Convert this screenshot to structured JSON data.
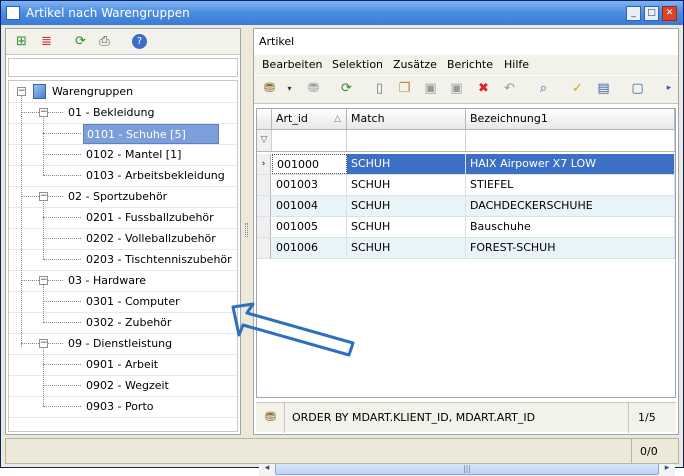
{
  "window": {
    "title": "Artikel nach Warengruppen"
  },
  "left": {
    "toolbar": [
      {
        "icon": "add-node-icon"
      },
      {
        "icon": "edit-list-icon"
      },
      {
        "icon": "refresh-icon"
      },
      {
        "icon": "print-icon"
      },
      {
        "icon": "help-icon"
      }
    ],
    "search_value": "",
    "tree": {
      "root": "Warengruppen",
      "groups": [
        {
          "label": "01 - Bekleidung",
          "children": [
            "0101 - Schuhe [5]",
            "0102 - Mantel [1]",
            "0103 - Arbeitsbekleidung"
          ]
        },
        {
          "label": "02 - Sportzubehör",
          "children": [
            "0201 - Fussballzubehör",
            "0202 - Volleballzubehör",
            "0203 - Tischtenniszubehör"
          ]
        },
        {
          "label": "03 - Hardware",
          "children": [
            "0301 - Computer",
            "0302 - Zubehör"
          ]
        },
        {
          "label": "09 - Dienstleistung",
          "children": [
            "0901 - Arbeit",
            "0902 - Wegzeit",
            "0903 - Porto"
          ]
        }
      ],
      "selected": "0101 - Schuhe [5]"
    }
  },
  "right": {
    "header": "Artikel",
    "menu": [
      "Bearbeiten",
      "Selektion",
      "Zusätze",
      "Berichte",
      "Hilfe"
    ],
    "grid": {
      "columns": [
        "Art_id",
        "Match",
        "Bezeichnung1"
      ],
      "rows": [
        {
          "art_id": "001000",
          "match": "SCHUH",
          "bezeichnung": "HAIX Airpower X7 LOW"
        },
        {
          "art_id": "001003",
          "match": "SCHUH",
          "bezeichnung": "STIEFEL"
        },
        {
          "art_id": "001004",
          "match": "SCHUH",
          "bezeichnung": "DACHDECKERSCHUHE"
        },
        {
          "art_id": "001005",
          "match": "SCHUH",
          "bezeichnung": "Bauschuhe"
        },
        {
          "art_id": "001006",
          "match": "SCHUH",
          "bezeichnung": "FOREST-SCHUH"
        }
      ]
    },
    "status": {
      "query": "ORDER BY MDART.KLIENT_ID, MDART.ART_ID",
      "count": "1/5"
    }
  },
  "bottom": {
    "count": "0/0"
  },
  "colors": {
    "selection": "#3d6fc4",
    "tree_selection": "#7c9fda",
    "arrow": "#2f6fc0"
  }
}
